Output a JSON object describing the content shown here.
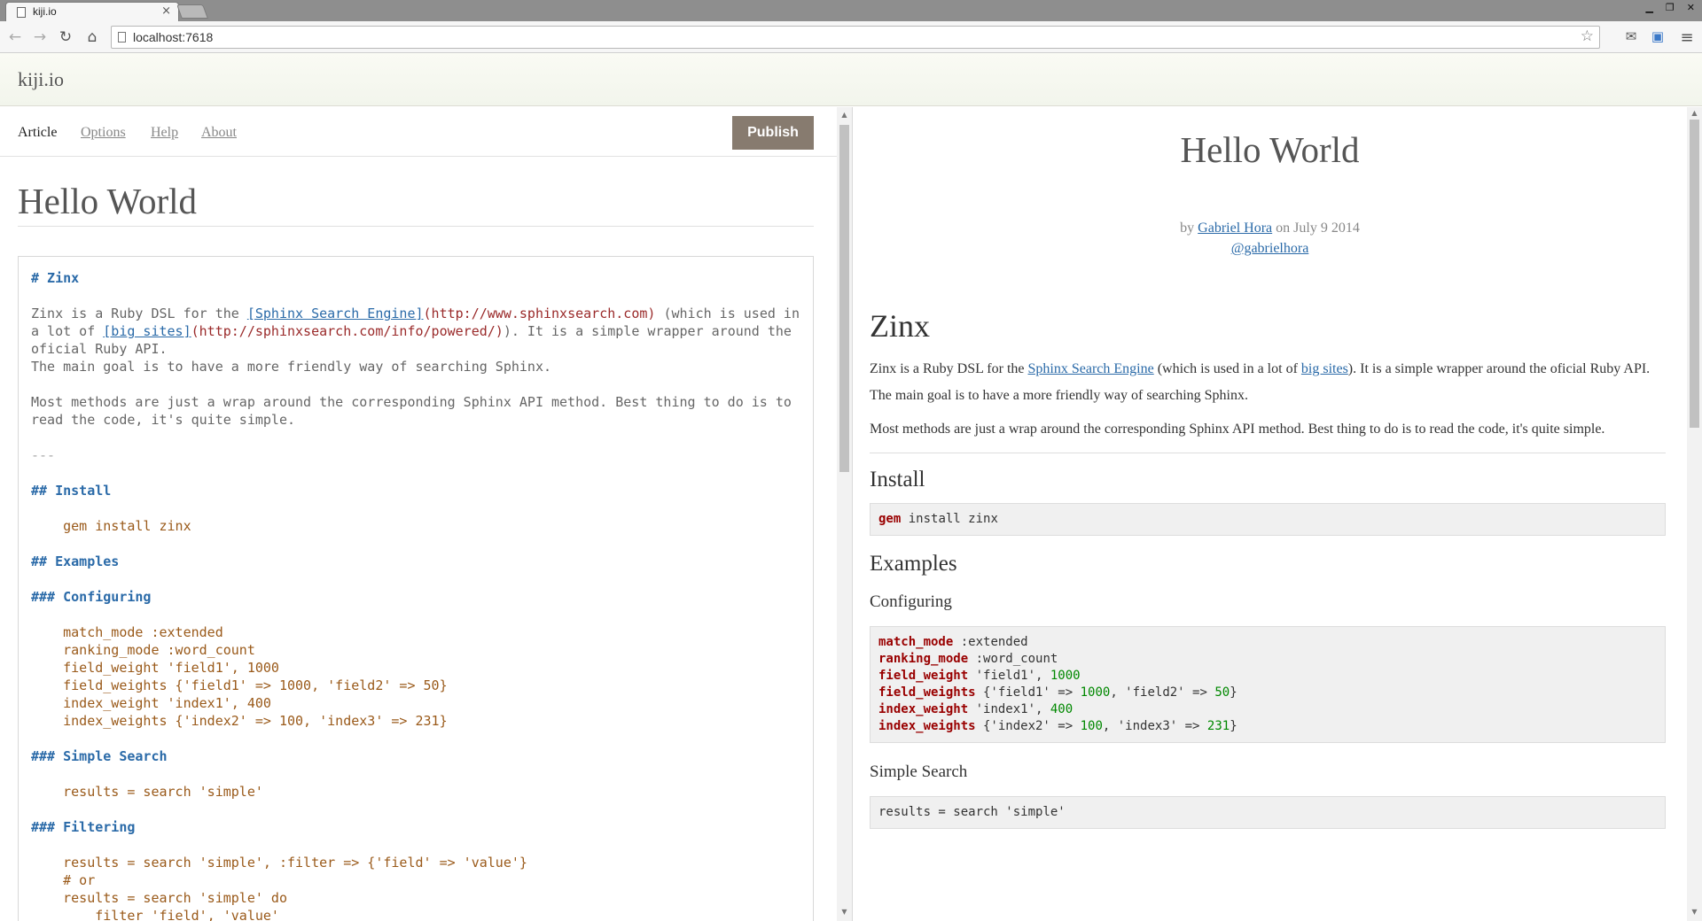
{
  "browser": {
    "tab_title": "kiji.io",
    "tab_close": "×",
    "url": "localhost:7618",
    "star_glyph": "☆",
    "back_glyph": "←",
    "forward_glyph": "→",
    "reload_glyph": "↻",
    "home_glyph": "⌂",
    "menu_glyph": "≡",
    "min_glyph": "▁",
    "restore_glyph": "❐",
    "close_glyph": "✕"
  },
  "app": {
    "logo": "kiji.io"
  },
  "nav": {
    "article": "Article",
    "options": "Options",
    "help": "Help",
    "about": "About",
    "publish": "Publish"
  },
  "editor": {
    "title": "Hello World",
    "lines": {
      "h1": "# Zinx",
      "p1a_pre": "Zinx is a Ruby DSL for the ",
      "p1a_link": "[Sphinx Search Engine]",
      "p1a_url": "(http://www.sphinxsearch.com)",
      "p1a_post": " (which is used in",
      "p1b_pre": "a lot of ",
      "p1b_link": "[big sites]",
      "p1b_url": "(http://sphinxsearch.com/info/powered/)",
      "p1b_post": "). It is a simple wrapper around the",
      "p1c": "oficial Ruby API.",
      "p1d": "The main goal is to have a more friendly way of searching Sphinx.",
      "p2a": "Most methods are just a wrap around the corresponding Sphinx API method. Best thing to do is to",
      "p2b": "read the code, it's quite simple.",
      "hr": "---",
      "h_install": "## Install",
      "code_install": "    gem install zinx",
      "h_examples": "## Examples",
      "h_configuring": "### Configuring",
      "c1": "    match_mode :extended",
      "c2": "    ranking_mode :word_count",
      "c3": "    field_weight 'field1', 1000",
      "c4": "    field_weights {'field1' => 1000, 'field2' => 50}",
      "c5": "    index_weight 'index1', 400",
      "c6": "    index_weights {'index2' => 100, 'index3' => 231}",
      "h_simple": "### Simple Search",
      "s1": "    results = search 'simple'",
      "h_filtering": "### Filtering",
      "f1": "    results = search 'simple', :filter => {'field' => 'value'}",
      "f2": "    # or",
      "f3": "    results = search 'simple' do",
      "f4": "        filter 'field', 'value'"
    }
  },
  "preview": {
    "title": "Hello World",
    "by": "by",
    "author": "Gabriel Hora",
    "date": "on July 9 2014",
    "handle": "@gabrielhora",
    "h1": "Zinx",
    "p1_a": "Zinx is a Ruby DSL for the ",
    "p1_link1": "Sphinx Search Engine",
    "p1_b": " (which is used in a lot of ",
    "p1_link2": "big sites",
    "p1_c": "). It is a simple wrapper around the oficial Ruby API.",
    "p1_d": "The main goal is to have a more friendly way of searching Sphinx.",
    "p2": "Most methods are just a wrap around the corresponding Sphinx API method. Best thing to do is to read the code, it's quite simple.",
    "h_install": "Install",
    "install_kw": "gem",
    "install_rest": " install zinx",
    "h_examples": "Examples",
    "h_configuring": "Configuring",
    "cfg": {
      "k1": "match_mode",
      "r1": " :extended",
      "k2": "ranking_mode",
      "r2": " :word_count",
      "k3": "field_weight",
      "r3a": " 'field1', ",
      "n3": "1000",
      "k4": "field_weights",
      "r4a": " {'field1' => ",
      "n4a": "1000",
      "r4b": ", 'field2' => ",
      "n4b": "50",
      "r4c": "}",
      "k5": "index_weight",
      "r5a": " 'index1', ",
      "n5": "400",
      "k6": "index_weights",
      "r6a": " {'index2' => ",
      "n6a": "100",
      "r6b": ", 'index3' => ",
      "n6b": "231",
      "r6c": "}"
    },
    "h_simple": "Simple Search",
    "simple_code": "results = search 'simple'"
  },
  "scrollbar": {
    "up": "▲",
    "down": "▼"
  }
}
